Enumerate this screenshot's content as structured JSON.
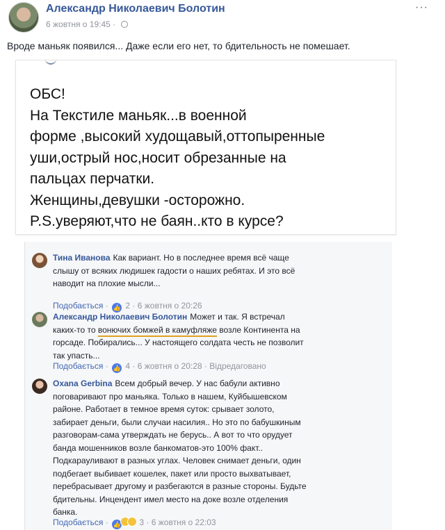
{
  "post": {
    "author": "Александр Николаевич Болотин",
    "date": "6 жовтня о 19:45 ·",
    "text": "Вроде маньяк появился... Даже если его нет, то бдительность не  помешает.",
    "more": "···"
  },
  "image_text": [
    "ОБС!",
    "На Текстиле маньяк...в военной",
    "форме ,высокий худощавый,оттопыренные",
    "уши,острый нос,носит обрезанные на",
    "пальцах перчатки.",
    "Женщины,девушки -осторожно.",
    "P.S.уверяют,что не баян..кто в курсе?"
  ],
  "comments": [
    {
      "name": "Тина Иванова",
      "lines": [
        "Как вариант. Но в последнее время всё чаще",
        "слышу от всяких людишек гадости о наших ребятах. И это всё",
        "наводит на плохие мысли..."
      ],
      "like_label": "Подобається",
      "likes": "2",
      "date": "6 жовтня о 20:26",
      "edited": ""
    },
    {
      "name": "Александр Николаевич Болотин",
      "line1": "Может и так. Я встречал",
      "line2_pre": "каких-то то ",
      "line2_mark": "вонючих бомжей в камуфляже",
      "line2_post": " возле Континента на",
      "lines_rest": [
        "горсаде. Побирались... У настоящего солдата честь не позволит",
        "так упасть..."
      ],
      "like_label": "Подобається",
      "likes": "4",
      "date": "6 жовтня о 20:28",
      "edited": "Відредаговано"
    },
    {
      "name": "Oxana Gerbina",
      "lines": [
        "Всем добрый вечер. У нас бабули активно",
        "поговаривают про маньяка. Только в нашем, Куйбышевском",
        "районе. Работает в темное время суток: срывает золото,",
        "забирает деньги, были случаи насилия.. Но это по бабушкиным",
        "разговорам-сама утверждать не берусь.. А вот то что орудует",
        "банда мошенников возле банкоматов-это 100% факт..",
        "Подкарауливают в разных углах. Человек снимает деньги, один",
        "подбегает выбивает кошелек, пакет или просто выхватывает,",
        "перебрасывает другому и разбегаются в разные стороны. Будьте",
        "бдительны. Инцендент имел место на доке возле отделения",
        "банка."
      ],
      "like_label": "Подобається",
      "likes": "3",
      "date": "6 жовтня о 22:03",
      "edited": ""
    }
  ]
}
